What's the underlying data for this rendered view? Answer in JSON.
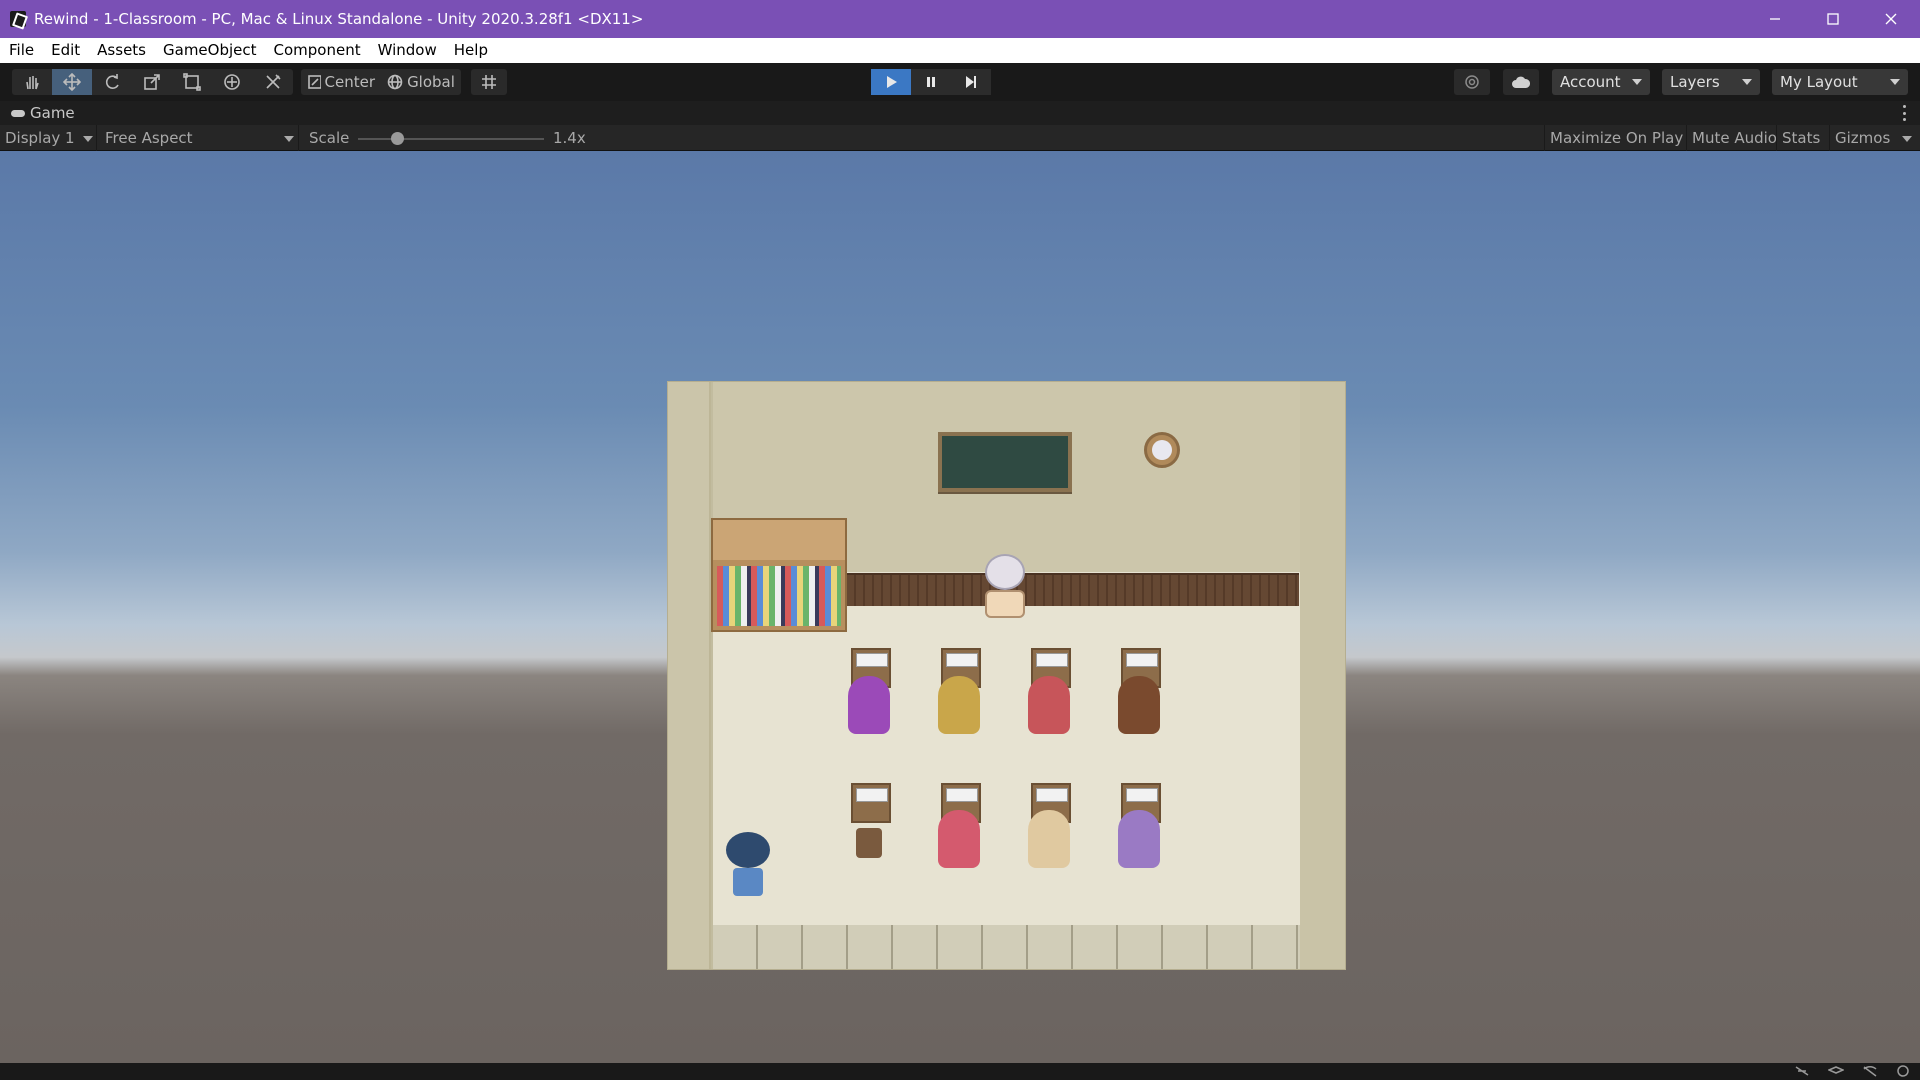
{
  "window": {
    "title": "Rewind - 1-Classroom - PC, Mac & Linux Standalone - Unity 2020.3.28f1 <DX11>"
  },
  "menu": [
    "File",
    "Edit",
    "Assets",
    "GameObject",
    "Component",
    "Window",
    "Help"
  ],
  "toolbar": {
    "pivot_label": "Center",
    "space_label": "Global",
    "account_label": "Account",
    "layers_label": "Layers",
    "layout_label": "My Layout"
  },
  "game_view": {
    "tab_label": "Game",
    "display_label": "Display 1",
    "aspect_label": "Free Aspect",
    "scale_label": "Scale",
    "scale_value": "1.4x",
    "maximize_label": "Maximize On Play",
    "mute_label": "Mute Audio",
    "stats_label": "Stats",
    "gizmos_label": "Gizmos"
  },
  "colors": {
    "titlebar": "#7a50b5",
    "play_active": "#3b78c4",
    "sky_top": "#5b79a8",
    "ground": "#6b6460"
  },
  "scene": {
    "students_row1": [
      "#9b4ab8",
      "#c9a64a",
      "#c7555a",
      "#7a4a2e"
    ],
    "students_row2": [
      "#d45a6e",
      "#e0c9a0",
      "#9a7ac4"
    ]
  }
}
